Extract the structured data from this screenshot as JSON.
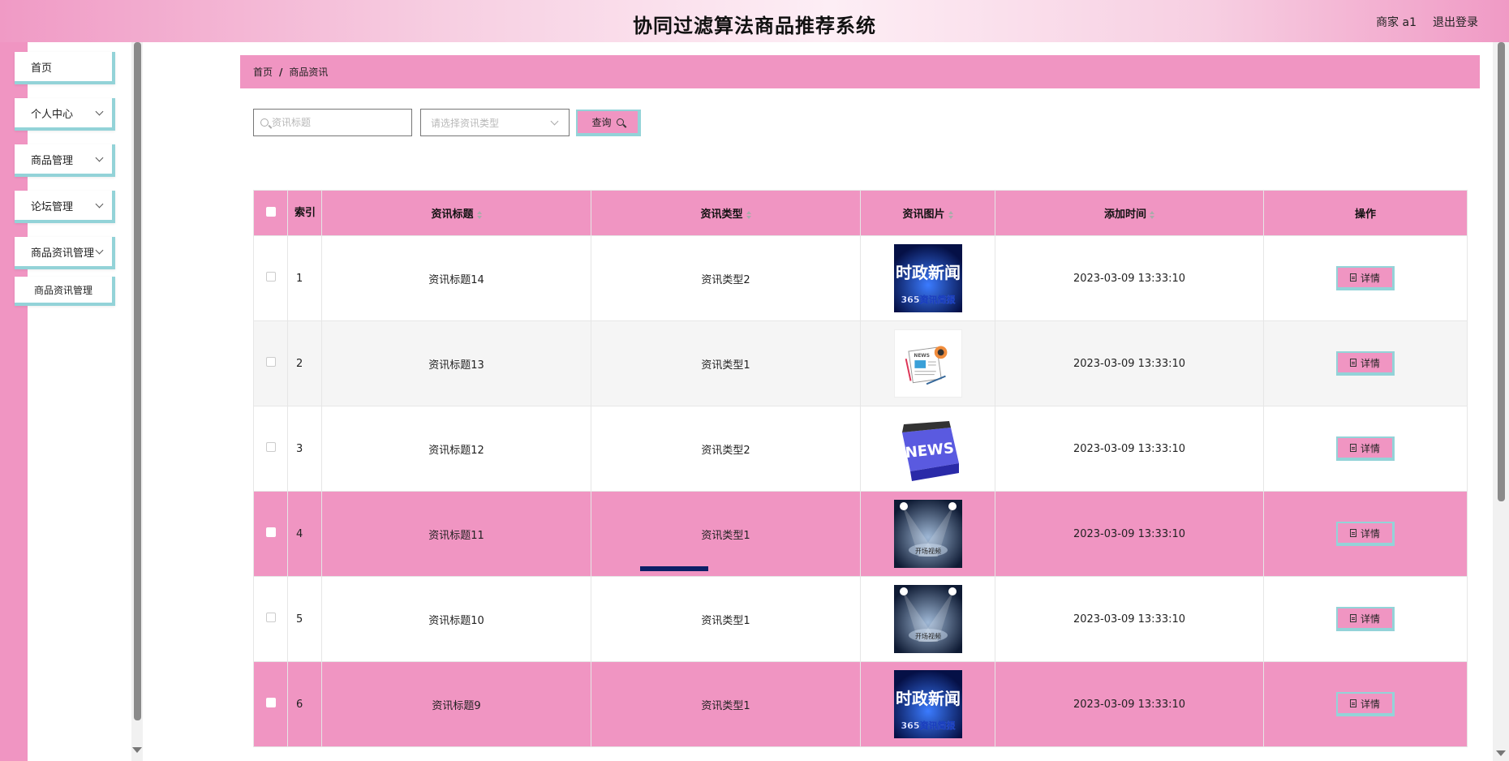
{
  "header": {
    "title": "协同过滤算法商品推荐系统",
    "user": "商家 a1",
    "logout": "退出登录"
  },
  "sidebar": {
    "items": [
      {
        "label": "首页",
        "has_children": false
      },
      {
        "label": "个人中心",
        "has_children": true
      },
      {
        "label": "商品管理",
        "has_children": true
      },
      {
        "label": "论坛管理",
        "has_children": true
      },
      {
        "label": "商品资讯管理",
        "has_children": true
      }
    ],
    "sub_item": "商品资讯管理"
  },
  "breadcrumb": {
    "home": "首页",
    "separator": "/",
    "current": "商品资讯"
  },
  "search": {
    "title_placeholder": "资讯标题",
    "type_placeholder": "请选择资讯类型",
    "query_label": "查询"
  },
  "table": {
    "columns": {
      "index": "索引",
      "title": "资讯标题",
      "type": "资讯类型",
      "image": "资讯图片",
      "time": "添加时间",
      "action": "操作"
    },
    "detail_label": "详情",
    "rows": [
      {
        "index": "1",
        "title": "资讯标题14",
        "type": "资讯类型2",
        "image": "news-politics-image",
        "time": "2023-03-09 13:33:10",
        "style": "normal"
      },
      {
        "index": "2",
        "title": "资讯标题13",
        "type": "资讯类型1",
        "image": "newspaper-image",
        "time": "2023-03-09 13:33:10",
        "style": "alt"
      },
      {
        "index": "3",
        "title": "资讯标题12",
        "type": "资讯类型2",
        "image": "news-key-image",
        "time": "2023-03-09 13:33:10",
        "style": "normal"
      },
      {
        "index": "4",
        "title": "资讯标题11",
        "type": "资讯类型1",
        "image": "spotlight-image",
        "time": "2023-03-09 13:33:10",
        "style": "highlight"
      },
      {
        "index": "5",
        "title": "资讯标题10",
        "type": "资讯类型1",
        "image": "spotlight-image",
        "time": "2023-03-09 13:33:10",
        "style": "normal"
      },
      {
        "index": "6",
        "title": "资讯标题9",
        "type": "资讯类型1",
        "image": "news-politics-image",
        "time": "2023-03-09 13:33:10",
        "style": "highlight"
      }
    ]
  },
  "image_text": {
    "politics_main": "时政新闻",
    "politics_sub": "365资讯简报",
    "news_key": "NEWS",
    "newspaper": "NEWS",
    "spotlight": "开场视频"
  },
  "colors": {
    "accent_pink": "#f095c2",
    "accent_teal": "#93d3d8"
  }
}
